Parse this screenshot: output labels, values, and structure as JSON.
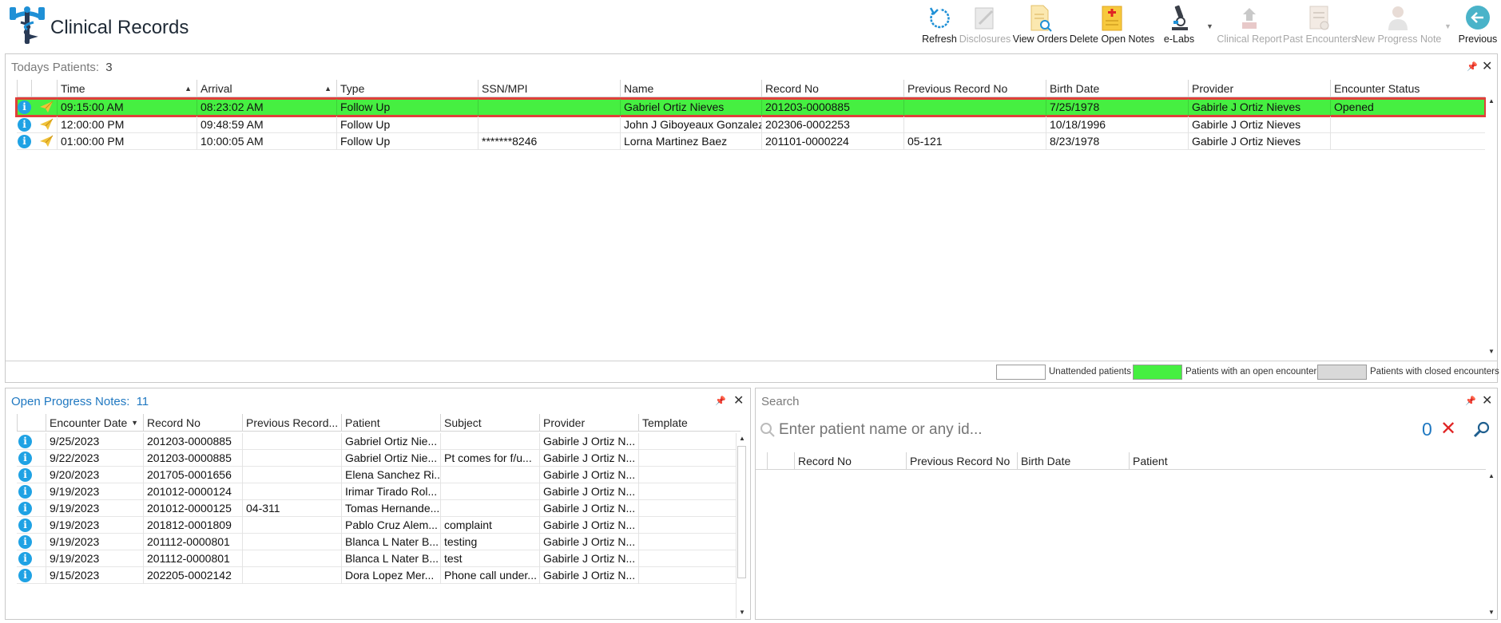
{
  "app": {
    "title": "Clinical Records"
  },
  "toolbar": {
    "refresh": "Refresh",
    "disclosures": "Disclosures",
    "view_orders": "View Orders",
    "delete_open_notes": "Delete Open Notes",
    "elabs": "e-Labs",
    "clinical_report": "Clinical Report",
    "past_encounters": "Past Encounters",
    "new_progress_note": "New Progress Note",
    "previous": "Previous"
  },
  "todays": {
    "title": "Todays Patients:",
    "count": "3",
    "columns": [
      "Time",
      "Arrival",
      "Type",
      "SSN/MPI",
      "Name",
      "Record No",
      "Previous Record No",
      "Birth Date",
      "Provider",
      "Encounter Status"
    ],
    "rows": [
      {
        "time": "09:15:00 AM",
        "arrival": "08:23:02 AM",
        "type": "Follow Up",
        "ssn": "",
        "name": "Gabriel Ortiz Nieves",
        "record": "201203-0000885",
        "prev": "",
        "birth": "7/25/1978",
        "provider": "Gabirle J Ortiz Nieves",
        "status": "Opened"
      },
      {
        "time": "12:00:00 PM",
        "arrival": "09:48:59 AM",
        "type": "Follow Up",
        "ssn": "",
        "name": "John J Giboyeaux Gonzalez",
        "record": "202306-0002253",
        "prev": "",
        "birth": "10/18/1996",
        "provider": "Gabirle J Ortiz Nieves",
        "status": ""
      },
      {
        "time": "01:00:00 PM",
        "arrival": "10:00:05 AM",
        "type": "Follow Up",
        "ssn": "*******8246",
        "name": "Lorna Martinez Baez",
        "record": "201101-0000224",
        "prev": "05-121",
        "birth": "8/23/1978",
        "provider": "Gabirle J Ortiz Nieves",
        "status": ""
      }
    ],
    "legend": {
      "unattended": "Unattended patients",
      "open": "Patients with an open encounter",
      "closed": "Patients with closed encounters"
    }
  },
  "notes": {
    "title": "Open Progress Notes:",
    "count": "11",
    "columns": [
      "Encounter Date",
      "Record No",
      "Previous Record...",
      "Patient",
      "Subject",
      "Provider",
      "Template"
    ],
    "rows": [
      {
        "date": "9/25/2023",
        "record": "201203-0000885",
        "prev": "",
        "patient": "Gabriel Ortiz Nie...",
        "subject": "",
        "provider": "Gabirle J Ortiz N...",
        "template": ""
      },
      {
        "date": "9/22/2023",
        "record": "201203-0000885",
        "prev": "",
        "patient": "Gabriel Ortiz Nie...",
        "subject": "Pt comes for f/u...",
        "provider": "Gabirle J Ortiz N...",
        "template": ""
      },
      {
        "date": "9/20/2023",
        "record": "201705-0001656",
        "prev": "",
        "patient": "Elena Sanchez Ri...",
        "subject": "",
        "provider": "Gabirle J Ortiz N...",
        "template": ""
      },
      {
        "date": "9/19/2023",
        "record": "201012-0000124",
        "prev": "",
        "patient": "Irimar Tirado Rol...",
        "subject": "",
        "provider": "Gabirle J Ortiz N...",
        "template": ""
      },
      {
        "date": "9/19/2023",
        "record": "201012-0000125",
        "prev": "04-311",
        "patient": "Tomas Hernande...",
        "subject": "",
        "provider": "Gabirle J Ortiz N...",
        "template": ""
      },
      {
        "date": "9/19/2023",
        "record": "201812-0001809",
        "prev": "",
        "patient": "Pablo Cruz Alem...",
        "subject": "complaint",
        "provider": "Gabirle J Ortiz N...",
        "template": ""
      },
      {
        "date": "9/19/2023",
        "record": "201112-0000801",
        "prev": "",
        "patient": "Blanca L Nater B...",
        "subject": "testing",
        "provider": "Gabirle J Ortiz N...",
        "template": ""
      },
      {
        "date": "9/19/2023",
        "record": "201112-0000801",
        "prev": "",
        "patient": "Blanca L Nater B...",
        "subject": "test",
        "provider": "Gabirle J Ortiz N...",
        "template": ""
      },
      {
        "date": "9/15/2023",
        "record": "202205-0002142",
        "prev": "",
        "patient": "Dora Lopez Mer...",
        "subject": "Phone call under...",
        "provider": "Gabirle J Ortiz N...",
        "template": ""
      }
    ]
  },
  "search": {
    "title": "Search",
    "placeholder": "Enter patient name or any id...",
    "result_count": "0",
    "columns": [
      "Record No",
      "Previous Record No",
      "Birth Date",
      "Patient"
    ]
  },
  "colors": {
    "open_encounter": "#46ef41",
    "closed_encounter": "#d9d9d9",
    "selected_outline": "#e0403a",
    "accent": "#1fa2e4"
  }
}
